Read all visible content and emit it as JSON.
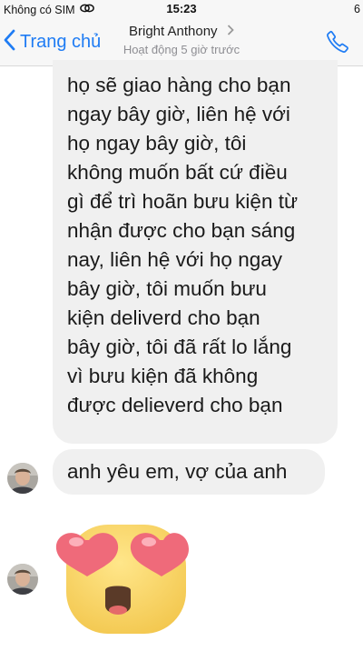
{
  "status_bar": {
    "carrier": "Không có SIM",
    "time": "15:23",
    "battery_partial": "6"
  },
  "header": {
    "back_label": "Trang chủ",
    "contact_name": "Bright Anthony",
    "presence": "Hoạt động 5 giờ trước"
  },
  "messages": [
    {
      "text": "họ sẽ giao hàng cho bạn\nngay bây giờ, liên hệ với\nhọ ngay bây giờ, tôi\nkhông muốn bất cứ điều\ngì để trì hoãn bưu kiện từ\nnhận được cho bạn sáng\nnay, liên hệ với họ ngay\nbây giờ, tôi muốn bưu\nkiện deliverd cho bạn\nbây giờ, tôi đã rất lo lắng\nvì bưu kiện đã không\nđược delieverd cho bạn"
    },
    {
      "text": "anh yêu em, vợ của anh"
    },
    {
      "emoji": "heart-eyes-emoji"
    }
  ],
  "colors": {
    "accent": "#1f7cf4",
    "bubble": "#f0f0f0",
    "header_bg": "#f7f7f7",
    "emoji_face": "#f9d96e",
    "heart": "#ef6a7a"
  },
  "icons": [
    "link-icon",
    "back-chevron-icon",
    "chevron-right-icon",
    "phone-icon",
    "heart-eyes-emoji"
  ]
}
